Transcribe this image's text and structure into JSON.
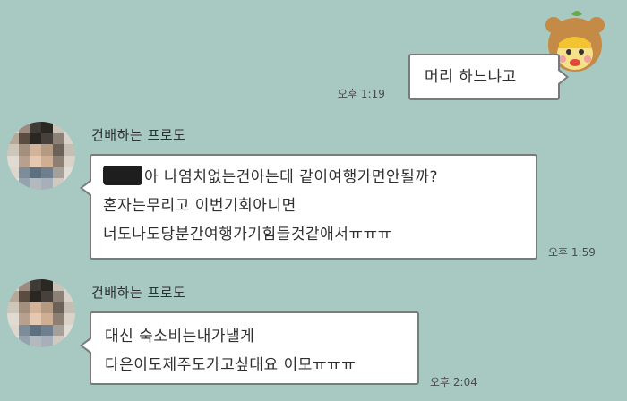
{
  "messages": {
    "outgoing": {
      "text": "머리 하느냐고",
      "time": "오후 1:19"
    },
    "incoming": [
      {
        "sender": "건배하는 프로도",
        "lines": [
          "아 나염치없는건아는데 같이여행가면안될까?",
          "혼자는무리고 이번기회아니면",
          "너도나도당분간여행가기힘들것같애서ㅠㅠㅠ"
        ],
        "time": "오후 1:59"
      },
      {
        "sender": "건배하는 프로도",
        "lines": [
          "대신 숙소비는내가낼게",
          "다은이도제주도가고싶대요 이모ㅠㅠㅠ"
        ],
        "time": "오후 2:04"
      }
    ]
  },
  "colors": {
    "background": "#a7c9c2",
    "bubble": "#ffffff",
    "bubble_border": "#7a7a7a"
  },
  "icons": {
    "my_avatar": "bear-hat-character-icon",
    "sender_avatar": "pixelated-profile-photo"
  }
}
